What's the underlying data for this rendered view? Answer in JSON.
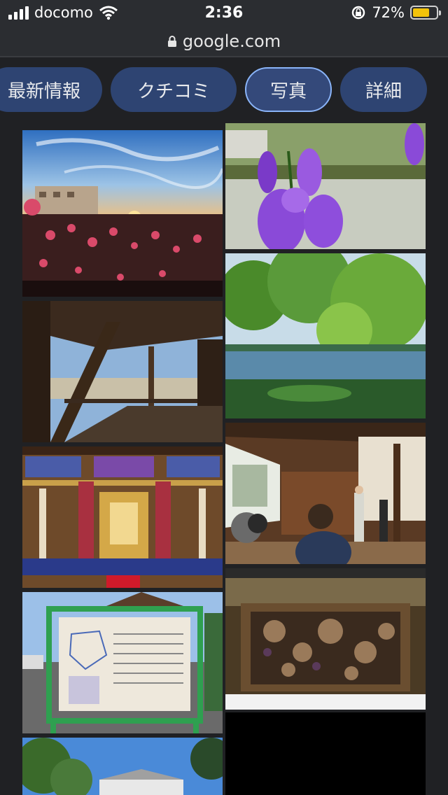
{
  "status_bar": {
    "carrier": "docomo",
    "time": "2:36",
    "battery": "72%",
    "battery_level": 0.72
  },
  "browser": {
    "url": "google.com"
  },
  "tabs": [
    {
      "label": "最新情報",
      "active": false
    },
    {
      "label": "クチコミ",
      "active": false
    },
    {
      "label": "写真",
      "active": true
    },
    {
      "label": "詳細",
      "active": false
    }
  ],
  "colors": {
    "tab_bg": "#2e4472",
    "tab_active_border": "#8ab4f8",
    "page_bg": "#202124",
    "battery": "#f2c30b"
  }
}
